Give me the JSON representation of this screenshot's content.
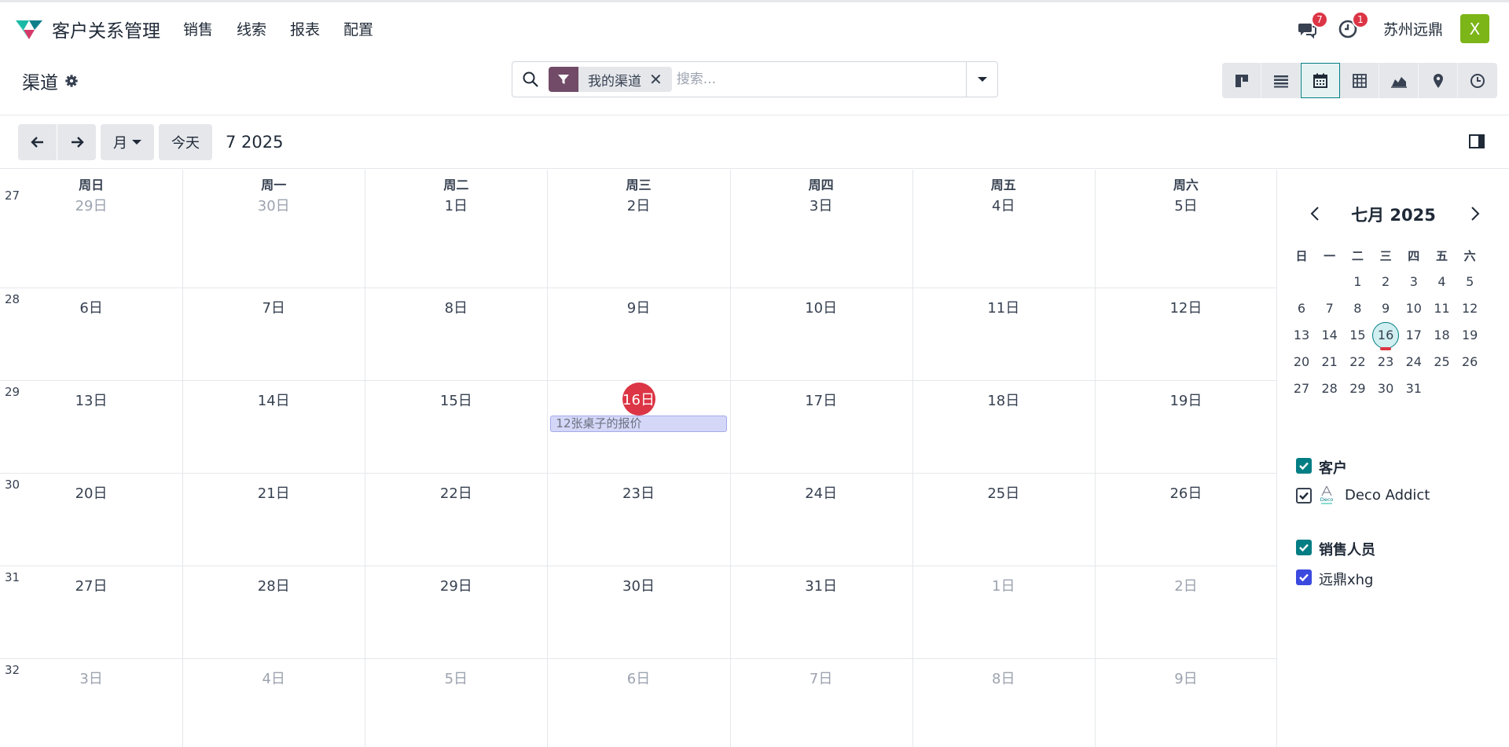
{
  "app": {
    "name": "客户关系管理",
    "menu": [
      "销售",
      "线索",
      "报表",
      "配置"
    ],
    "messages_badge": "7",
    "activities_badge": "1",
    "company": "苏州远鼎",
    "avatar_letter": "X",
    "brand_color": "#017e84",
    "avatar_color": "#7cb518"
  },
  "control": {
    "title": "渠道",
    "facet_label": "我的渠道",
    "facet_close": "✕",
    "search_placeholder": "搜索...",
    "views": [
      "kanban-icon",
      "list-icon",
      "calendar-icon",
      "pivot-icon",
      "graph-icon",
      "map-icon",
      "activity-icon"
    ],
    "active_view": "calendar-icon"
  },
  "toolbar": {
    "scale": "月",
    "today": "今天",
    "period": "7 2025"
  },
  "calendar": {
    "weekdays": [
      "周日",
      "周一",
      "周二",
      "周三",
      "周四",
      "周五",
      "周六"
    ],
    "weeks": [
      {
        "num": "27",
        "days": [
          {
            "d": "29日",
            "m": true
          },
          {
            "d": "30日",
            "m": true
          },
          {
            "d": "1日"
          },
          {
            "d": "2日"
          },
          {
            "d": "3日"
          },
          {
            "d": "4日"
          },
          {
            "d": "5日"
          }
        ]
      },
      {
        "num": "28",
        "days": [
          {
            "d": "6日"
          },
          {
            "d": "7日"
          },
          {
            "d": "8日"
          },
          {
            "d": "9日"
          },
          {
            "d": "10日"
          },
          {
            "d": "11日"
          },
          {
            "d": "12日"
          }
        ]
      },
      {
        "num": "29",
        "days": [
          {
            "d": "13日"
          },
          {
            "d": "14日"
          },
          {
            "d": "15日"
          },
          {
            "d": "16日",
            "today": true
          },
          {
            "d": "17日"
          },
          {
            "d": "18日"
          },
          {
            "d": "19日"
          }
        ]
      },
      {
        "num": "30",
        "days": [
          {
            "d": "20日"
          },
          {
            "d": "21日"
          },
          {
            "d": "22日"
          },
          {
            "d": "23日"
          },
          {
            "d": "24日"
          },
          {
            "d": "25日"
          },
          {
            "d": "26日"
          }
        ]
      },
      {
        "num": "31",
        "days": [
          {
            "d": "27日"
          },
          {
            "d": "28日"
          },
          {
            "d": "29日"
          },
          {
            "d": "30日"
          },
          {
            "d": "31日"
          },
          {
            "d": "1日",
            "m": true
          },
          {
            "d": "2日",
            "m": true
          }
        ]
      },
      {
        "num": "32",
        "days": [
          {
            "d": "3日",
            "m": true
          },
          {
            "d": "4日",
            "m": true
          },
          {
            "d": "5日",
            "m": true
          },
          {
            "d": "6日",
            "m": true
          },
          {
            "d": "7日",
            "m": true
          },
          {
            "d": "8日",
            "m": true
          },
          {
            "d": "9日",
            "m": true
          }
        ]
      }
    ],
    "event": {
      "title": "12张桌子的报价",
      "week": 2,
      "weekday": 3
    },
    "today_color": "#dc3545"
  },
  "mini_calendar": {
    "title": "七月 2025",
    "dow": [
      "日",
      "一",
      "二",
      "三",
      "四",
      "五",
      "六"
    ],
    "rows": [
      [
        "",
        "",
        "1",
        "2",
        "3",
        "4",
        "5"
      ],
      [
        "6",
        "7",
        "8",
        "9",
        "10",
        "11",
        "12"
      ],
      [
        "13",
        "14",
        "15",
        "16",
        "17",
        "18",
        "19"
      ],
      [
        "20",
        "21",
        "22",
        "23",
        "24",
        "25",
        "26"
      ],
      [
        "27",
        "28",
        "29",
        "30",
        "31",
        "",
        ""
      ]
    ],
    "today": "16"
  },
  "filters": {
    "customer_title": "客户",
    "customer_item": "Deco Addict",
    "customer_logo_text": "Deco",
    "salesperson_title": "销售人员",
    "salesperson_item": "远鼎xhg"
  }
}
